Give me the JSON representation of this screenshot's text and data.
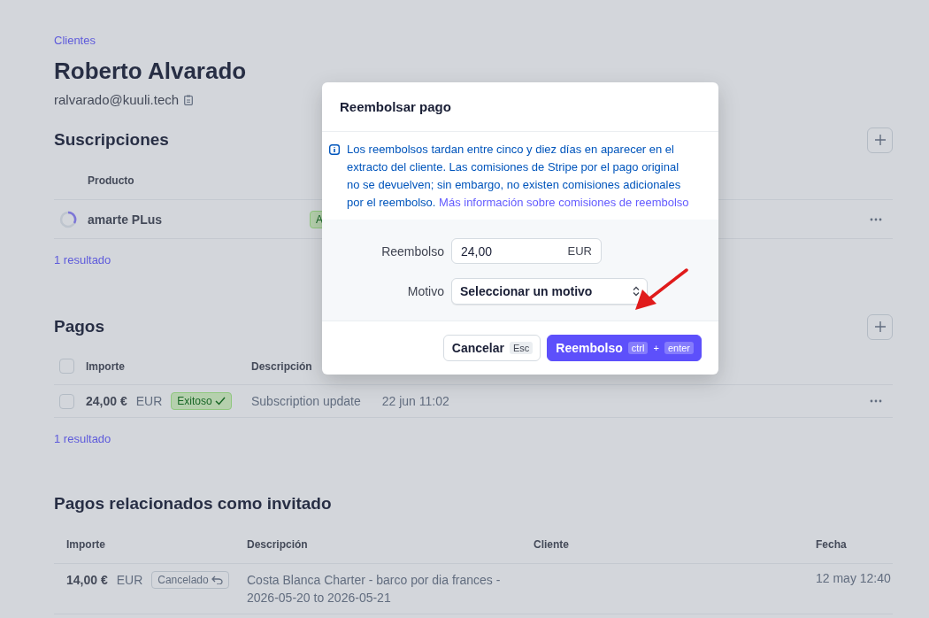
{
  "breadcrumb": "Clientes",
  "customer": {
    "name": "Roberto Alvarado",
    "email": "ralvarado@kuuli.tech"
  },
  "subscriptions": {
    "title": "Suscripciones",
    "columns": [
      "Producto"
    ],
    "rows": [
      {
        "product": "amarte PLus",
        "status": {
          "kind": "active",
          "label": "A"
        }
      }
    ],
    "result_count": "1 resultado"
  },
  "payments": {
    "title": "Pagos",
    "header_checked": false,
    "columns": [
      "Importe",
      "Descripción"
    ],
    "rows": [
      {
        "checked": false,
        "amount": "24,00 €",
        "currency": "EUR",
        "status": {
          "kind": "success",
          "label": "Exitoso"
        },
        "description": "Subscription update",
        "date": "22 jun 11:02"
      }
    ],
    "result_count": "1 resultado"
  },
  "guest_payments": {
    "title": "Pagos relacionados como invitado",
    "columns": [
      "Importe",
      "Descripción",
      "Cliente",
      "Fecha"
    ],
    "rows": [
      {
        "amount": "14,00 €",
        "currency": "EUR",
        "status": {
          "kind": "canceled",
          "label": "Cancelado"
        },
        "description": "Costa Blanca Charter - barco por dia frances - 2026-05-20 to 2026-05-21",
        "date": "12 may 12:40"
      }
    ]
  },
  "dialog": {
    "title": "Reembolsar pago",
    "notice": "Los reembolsos tardan entre cinco y diez días en aparecer en el extracto del cliente. Las comisiones de Stripe por el pago original no se devuelven; sin embargo, no existen comisiones adicionales por el reembolso.",
    "notice_link": "Más información sobre comisiones de reembolso",
    "amount_label": "Reembolso",
    "amount_value": "24,00",
    "amount_currency": "EUR",
    "reason_label": "Motivo",
    "reason_placeholder": "Seleccionar un motivo",
    "cancel": {
      "label": "Cancelar",
      "key": "Esc"
    },
    "confirm": {
      "label": "Reembolso",
      "keys": [
        "ctrl",
        "enter"
      ],
      "joiner": "+"
    }
  }
}
